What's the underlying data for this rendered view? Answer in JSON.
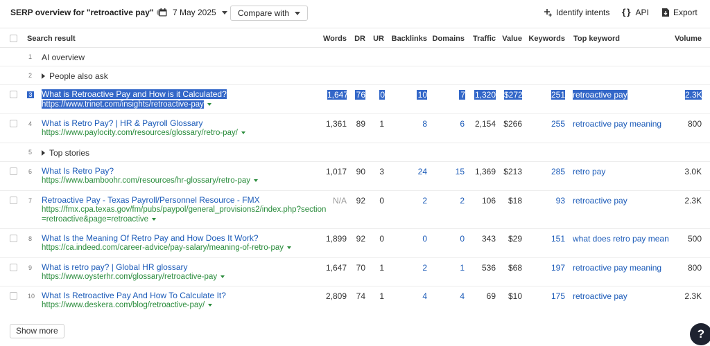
{
  "toolbar": {
    "title": "SERP overview for \"retroactive pay\"",
    "date": "7 May 2025",
    "compare_label": "Compare with",
    "identify_label": "Identify intents",
    "api_label": "API",
    "export_label": "Export"
  },
  "columns": {
    "search_result": "Search result",
    "words": "Words",
    "dr": "DR",
    "ur": "UR",
    "backlinks": "Backlinks",
    "domains": "Domains",
    "traffic": "Traffic",
    "value": "Value",
    "keywords": "Keywords",
    "top_keyword": "Top keyword",
    "volume": "Volume"
  },
  "rows": [
    {
      "num": "1",
      "label": "AI overview"
    },
    {
      "num": "2",
      "label": "People also ask"
    },
    {
      "num": "3",
      "title": "What is Retroactive Pay and How is it Calculated?",
      "url": "https://www.trinet.com/insights/retroactive-pay",
      "words": "1,647",
      "dr": "76",
      "ur": "0",
      "backlinks": "10",
      "domains": "7",
      "traffic": "1,320",
      "value": "$272",
      "keywords": "251",
      "top_keyword": "retroactive pay",
      "volume": "2.3K"
    },
    {
      "num": "4",
      "title": "What is Retro Pay? | HR & Payroll Glossary",
      "url": "https://www.paylocity.com/resources/glossary/retro-pay/",
      "words": "1,361",
      "dr": "89",
      "ur": "1",
      "backlinks": "8",
      "domains": "6",
      "traffic": "2,154",
      "value": "$266",
      "keywords": "255",
      "top_keyword": "retroactive pay meaning",
      "volume": "800"
    },
    {
      "num": "5",
      "label": "Top stories"
    },
    {
      "num": "6",
      "title": "What Is Retro Pay?",
      "url": "https://www.bamboohr.com/resources/hr-glossary/retro-pay",
      "words": "1,017",
      "dr": "90",
      "ur": "3",
      "backlinks": "24",
      "domains": "15",
      "traffic": "1,369",
      "value": "$213",
      "keywords": "285",
      "top_keyword": "retro pay",
      "volume": "3.0K"
    },
    {
      "num": "7",
      "title": "Retroactive Pay - Texas Payroll/Personnel Resource - FMX",
      "url_line1": "https://fmx.cpa.texas.gov/fm/pubs/paypol/general_provisions2/index.php?section",
      "url_line2": "=retroactive&page=retroactive",
      "words": "N/A",
      "dr": "92",
      "ur": "0",
      "backlinks": "2",
      "domains": "2",
      "traffic": "106",
      "value": "$18",
      "keywords": "93",
      "top_keyword": "retroactive pay",
      "volume": "2.3K"
    },
    {
      "num": "8",
      "title": "What Is the Meaning Of Retro Pay and How Does It Work?",
      "url": "https://ca.indeed.com/career-advice/pay-salary/meaning-of-retro-pay",
      "words": "1,899",
      "dr": "92",
      "ur": "0",
      "backlinks": "0",
      "domains": "0",
      "traffic": "343",
      "value": "$29",
      "keywords": "151",
      "top_keyword": "what does retro pay mean",
      "volume": "500"
    },
    {
      "num": "9",
      "title": "What is retro pay? | Global HR glossary",
      "url": "https://www.oysterhr.com/glossary/retroactive-pay",
      "words": "1,647",
      "dr": "70",
      "ur": "1",
      "backlinks": "2",
      "domains": "1",
      "traffic": "536",
      "value": "$68",
      "keywords": "197",
      "top_keyword": "retroactive pay meaning",
      "volume": "800"
    },
    {
      "num": "10",
      "title": "What Is Retroactive Pay And How To Calculate It?",
      "url": "https://www.deskera.com/blog/retroactive-pay/",
      "words": "2,809",
      "dr": "74",
      "ur": "1",
      "backlinks": "4",
      "domains": "4",
      "traffic": "69",
      "value": "$10",
      "keywords": "175",
      "top_keyword": "retroactive pay",
      "volume": "2.3K"
    }
  ],
  "footer": {
    "show_more_label": "Show more",
    "help_label": "?"
  },
  "colors": {
    "link": "#1a5ab8",
    "url": "#2a8c3c",
    "selection": "#3367c8"
  }
}
